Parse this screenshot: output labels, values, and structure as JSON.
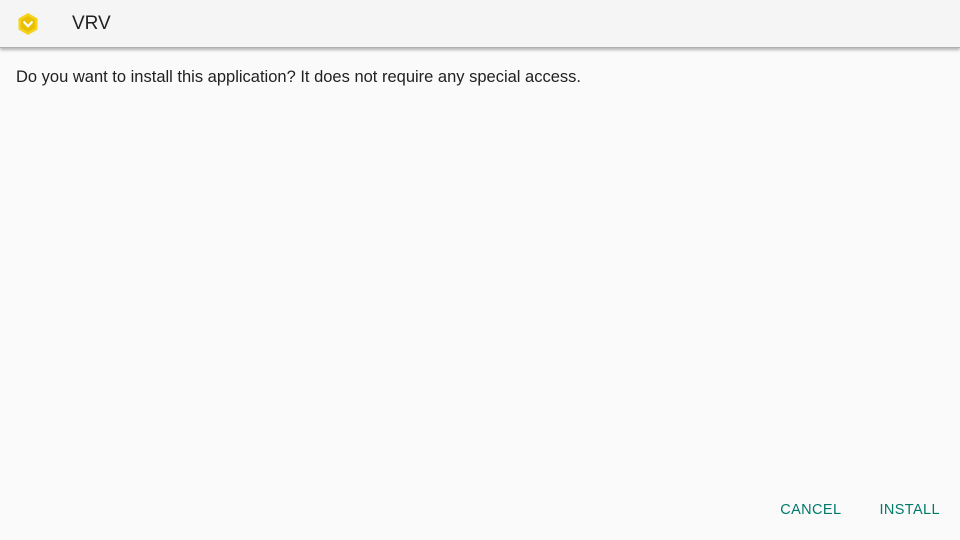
{
  "header": {
    "title": "VRV",
    "icon": "vrv-app-icon",
    "icon_color": "#f6d21d"
  },
  "main": {
    "message": "Do you want to install this application? It does not require any special access."
  },
  "actions": {
    "cancel_label": "CANCEL",
    "install_label": "INSTALL",
    "accent_color": "#00796b"
  }
}
